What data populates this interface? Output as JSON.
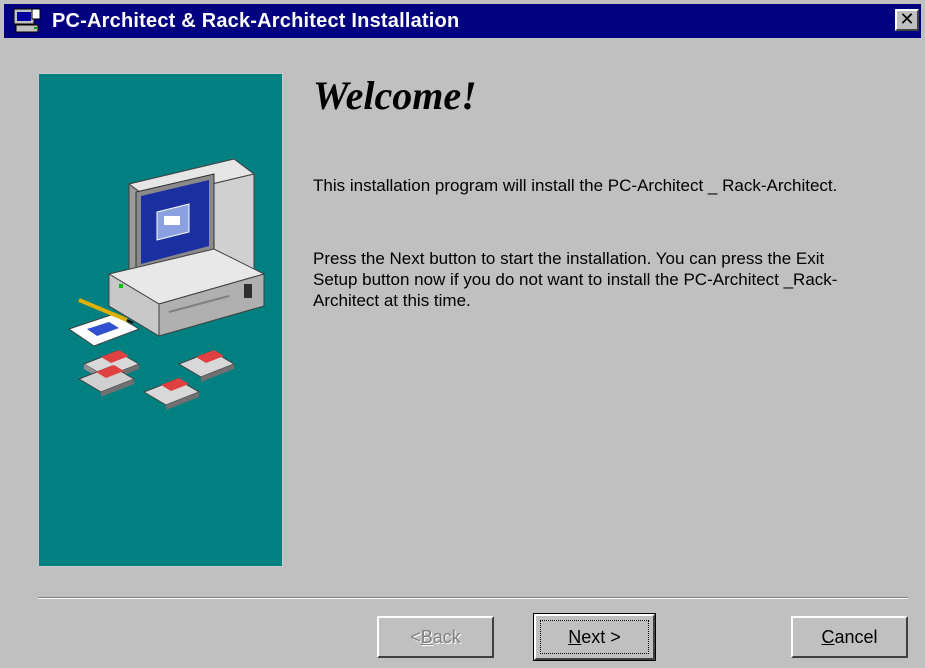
{
  "window": {
    "title": "PC-Architect & Rack-Architect Installation",
    "close_label": "✕"
  },
  "welcome": {
    "heading": "Welcome!",
    "paragraph1": "This installation program will install the PC-Architect _ Rack-Architect.",
    "paragraph2": "Press the Next button to start the installation. You can press the Exit Setup button now if you do not want to install the PC-Architect _Rack-Architect at this time."
  },
  "buttons": {
    "back_prefix": "< ",
    "back_accel": "B",
    "back_rest": "ack",
    "next_accel": "N",
    "next_rest": "ext >",
    "cancel_accel": "C",
    "cancel_rest": "ancel"
  },
  "colors": {
    "titlebar": "#000080",
    "side_panel": "#008080",
    "dialog_face": "#c0c0c0"
  },
  "icons": {
    "title_icon": "setup-computer-icon",
    "illustration": "computer-with-disks-illustration"
  }
}
